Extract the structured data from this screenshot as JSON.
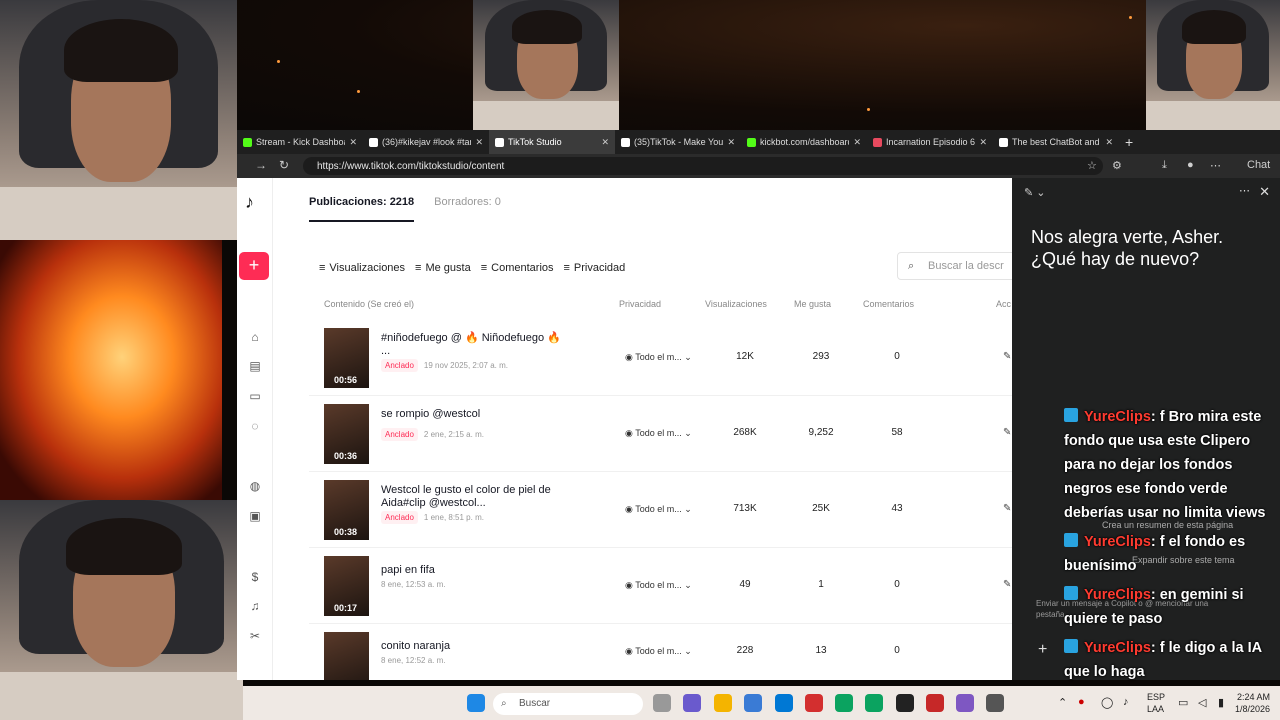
{
  "browser": {
    "tabs": [
      {
        "label": "Stream - Kick Dashboard",
        "color": "#53fc18",
        "active": false
      },
      {
        "label": "(36)#kikejav #look #tam",
        "color": "#ffffff",
        "active": false
      },
      {
        "label": "TikTok Studio",
        "color": "#ffffff",
        "active": true
      },
      {
        "label": "(35)TikTok - Make Your",
        "color": "#ffffff",
        "active": false
      },
      {
        "label": "kickbot.com/dashboard",
        "color": "#53fc18",
        "active": false
      },
      {
        "label": "Incarnation Episodio 6",
        "color": "#e84a5f",
        "active": false
      },
      {
        "label": "The best ChatBot and V",
        "color": "#ffffff",
        "active": false
      }
    ],
    "url": "https://www.tiktok.com/tiktokstudio/content",
    "chat_label": "Chat"
  },
  "tiktok": {
    "tab_posts": "Publicaciones: 2218",
    "tab_drafts": "Borradores: 0",
    "filters": [
      "Visualizaciones",
      "Me gusta",
      "Comentarios",
      "Privacidad"
    ],
    "search_placeholder": "Buscar la descr",
    "columns": {
      "content": "Contenido (Se creó el)",
      "privacy": "Privacidad",
      "views": "Visualizaciones",
      "likes": "Me gusta",
      "comments": "Comentarios",
      "actions": "Acc"
    },
    "rows": [
      {
        "title": "#niñodefuego @ 🔥 Niñodefuego 🔥 ...",
        "duration": "00:56",
        "pinned": "Anclado",
        "date": "19 nov 2025, 2:07 a. m.",
        "privacy": "Todo el m...",
        "views": "12K",
        "likes": "293",
        "comments": "0"
      },
      {
        "title": "se rompio @westcol",
        "duration": "00:36",
        "pinned": "Anclado",
        "date": "2 ene, 2:15 a. m.",
        "privacy": "Todo el m...",
        "views": "268K",
        "likes": "9,252",
        "comments": "58"
      },
      {
        "title": "Westcol le gusto el color de piel de Aida#clip @westcol...",
        "duration": "00:38",
        "pinned": "Anclado",
        "date": "1 ene, 8:51 p. m.",
        "privacy": "Todo el m...",
        "views": "713K",
        "likes": "25K",
        "comments": "43"
      },
      {
        "title": "papi en fifa",
        "duration": "00:17",
        "pinned": "",
        "date": "8 ene, 12:53 a. m.",
        "privacy": "Todo el m...",
        "views": "49",
        "likes": "1",
        "comments": "0"
      },
      {
        "title": "conito naranja",
        "duration": "",
        "pinned": "",
        "date": "8 ene, 12:52 a. m.",
        "privacy": "Todo el m...",
        "views": "228",
        "likes": "13",
        "comments": "0"
      }
    ]
  },
  "copilot": {
    "greeting": "Nos alegra verte, Asher. ¿Qué hay de nuevo?",
    "suggestion1": "Crea un resumen de esta página",
    "suggestion2": "Expandir sobre este tema",
    "input_placeholder": "Enviar un mensaje a Copilot o @ mencionar una pestaña"
  },
  "chat_overlay": [
    {
      "user": "YureClips",
      "text": ": f Bro mira este fondo que usa este Clipero para no dejar los fondos negros ese fondo verde deberías usar no limita views"
    },
    {
      "user": "YureClips",
      "text": ": f el fondo es buenísimo"
    },
    {
      "user": "YureClips",
      "text": ": en gemini si quiere te paso"
    },
    {
      "user": "YureClips",
      "text": ": f le digo a la IA que lo haga"
    }
  ],
  "taskbar": {
    "search": "Buscar",
    "lang1": "ESP",
    "lang2": "LAA",
    "time": "2:24 AM",
    "date": "1/8/2026"
  }
}
